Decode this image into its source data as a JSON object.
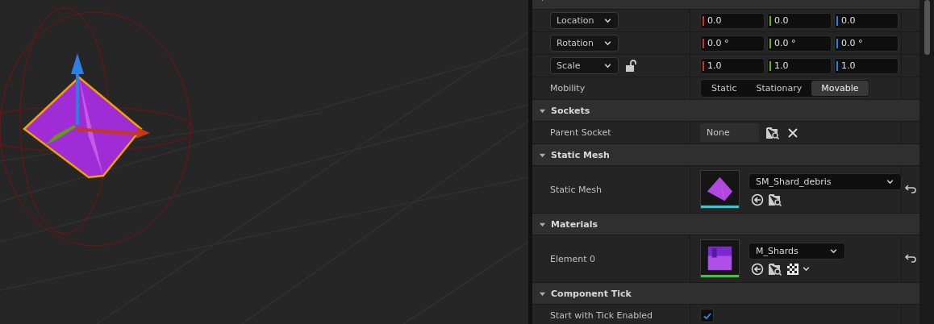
{
  "sections": [
    {
      "expanded": true,
      "rows": [
        {
          "kind": "vector",
          "label": "Location",
          "values": [
            "0.0",
            "0.0",
            "0.0"
          ],
          "locked": null
        },
        {
          "kind": "vector",
          "label": "Rotation",
          "values": [
            "0.0 °",
            "0.0 °",
            "0.0 °"
          ],
          "locked": null
        },
        {
          "kind": "vector",
          "label": "Scale",
          "values": [
            "1.0",
            "1.0",
            "1.0"
          ],
          "locked": false
        },
        {
          "kind": "mobility",
          "label": "Mobility",
          "options": [
            {
              "label": "Static",
              "selected": false
            },
            {
              "label": "Stationary",
              "selected": false
            },
            {
              "label": "Movable",
              "selected": true
            }
          ]
        }
      ]
    },
    {
      "title": "Sockets",
      "expanded": true,
      "rows": [
        {
          "kind": "socket",
          "label": "Parent Socket",
          "value": "None"
        }
      ]
    },
    {
      "title": "Static Mesh",
      "expanded": true,
      "rows": [
        {
          "kind": "mesh_asset",
          "label": "Static Mesh",
          "value": "SM_Shard_debris",
          "color": "#1fd3e0",
          "wide": true
        }
      ]
    },
    {
      "title": "Materials",
      "expanded": true,
      "rows": [
        {
          "kind": "material_asset",
          "label": "Element 0",
          "value": "M_Shards",
          "color": "#3ec43e",
          "wide": false
        }
      ]
    },
    {
      "title": "Component Tick",
      "expanded": true,
      "rows": [
        {
          "kind": "checkbox",
          "label": "Start with Tick Enabled",
          "checked": true
        }
      ]
    }
  ]
}
